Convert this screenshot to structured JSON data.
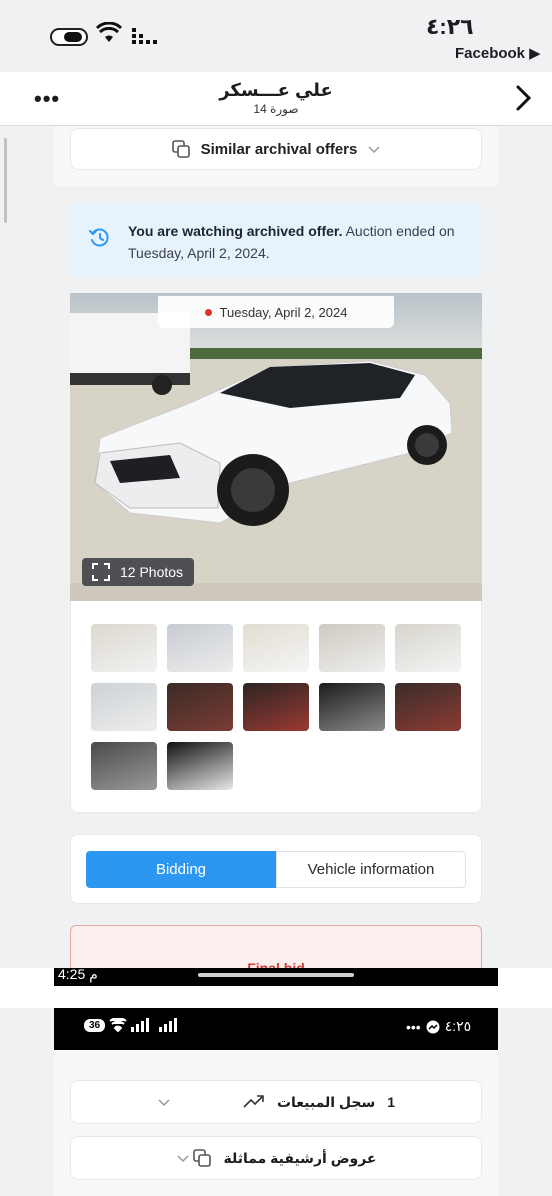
{
  "status_bar": {
    "time": "٤:٢٦",
    "source_app": "Facebook ▶"
  },
  "header": {
    "title": "علي عـــسكر",
    "subtitle": "14 صورة",
    "more_icon": "more-dots-icon",
    "forward_icon": "chevron-right-icon"
  },
  "similar": {
    "label": "Similar archival offers"
  },
  "notice": {
    "bold": "You are watching archived offer.",
    "text": " Auction ended on Tuesday, April 2, 2024."
  },
  "gallery": {
    "date_label": "Tuesday, April 2, 2024",
    "photos_count": "12 Photos",
    "thumbnails": [
      "front-left exterior",
      "left side exterior",
      "front damage",
      "front damage close",
      "front exterior",
      "rear exterior",
      "interior seats",
      "red leather seats",
      "instrument cluster",
      "rear seats",
      "engine bay",
      "vin sticker"
    ]
  },
  "tabs": {
    "bidding": "Bidding",
    "vehicle_info": "Vehicle information"
  },
  "final_bid": {
    "label": "Final bid"
  },
  "second_capture": {
    "top_time": "4:25 م",
    "status_time": "٤:٢٥",
    "battery": "36",
    "dots": "•••"
  },
  "rows": {
    "sales_history_count": "1",
    "sales_history_label": "سجل المبيعات",
    "similar_arabic": "عروض أرشيفية مماثلة"
  },
  "colors": {
    "accent": "#2b97f0",
    "notice_bg": "#e6f3fc",
    "alert": "#d03b32"
  }
}
